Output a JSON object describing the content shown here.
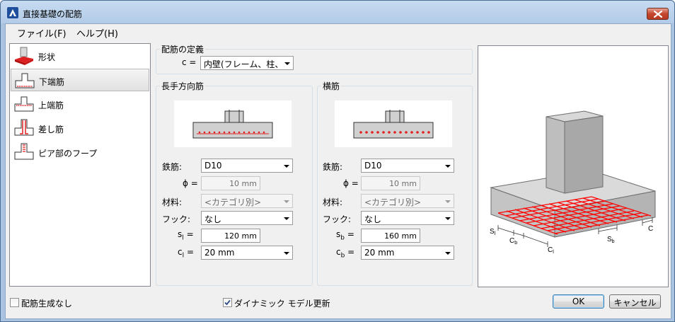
{
  "window": {
    "title": "直接基礎の配筋",
    "close_icon": "close-icon"
  },
  "menu": {
    "file": "ファイル(F)",
    "help": "ヘルプ(H)"
  },
  "sidebar": {
    "items": [
      {
        "label": "形状",
        "icon": "footing-shape-icon"
      },
      {
        "label": "下端筋",
        "icon": "bottom-rebar-icon"
      },
      {
        "label": "上端筋",
        "icon": "top-rebar-icon"
      },
      {
        "label": "差し筋",
        "icon": "dowel-rebar-icon"
      },
      {
        "label": "ピア部のフープ",
        "icon": "pier-hoop-icon"
      }
    ],
    "selected_index": 1
  },
  "definition": {
    "title": "配筋の定義",
    "c_label": "c =",
    "c_value": "内壁(フレーム、柱、およ"
  },
  "longitudinal": {
    "title": "長手方向筋",
    "bar_label": "鉄筋:",
    "bar_value": "D10",
    "phi_label": "ϕ =",
    "phi_value": "10 mm",
    "material_label": "材料:",
    "material_value": "<カテゴリ別>",
    "hook_label": "フック:",
    "hook_value": "なし",
    "spacing_label_main": "s",
    "spacing_label_sub": "l",
    "spacing_label_eq": "=",
    "spacing_value": "120 mm",
    "cover_label_main": "c",
    "cover_label_sub": "l",
    "cover_label_eq": "=",
    "cover_value": "20 mm"
  },
  "transverse": {
    "title": "横筋",
    "bar_label": "鉄筋:",
    "bar_value": "D10",
    "phi_label": "ϕ =",
    "phi_value": "10 mm",
    "material_label": "材料:",
    "material_value": "<カテゴリ別>",
    "hook_label": "フック:",
    "hook_value": "なし",
    "spacing_label_main": "s",
    "spacing_label_sub": "b",
    "spacing_label_eq": "=",
    "spacing_value": "160 mm",
    "cover_label_main": "c",
    "cover_label_sub": "b",
    "cover_label_eq": "=",
    "cover_value": "20 mm"
  },
  "preview": {
    "labels": {
      "s_l_main": "S",
      "s_l_sub": "l",
      "c_b_main": "C",
      "c_b_sub": "b",
      "c_l_main": "C",
      "c_l_sub": "l",
      "s_b_main": "S",
      "s_b_sub": "b",
      "c": "C"
    },
    "rebar_color": "#ff0000",
    "concrete_color": "#c8c8c8"
  },
  "footer": {
    "no_rebar_label": "配筋生成なし",
    "no_rebar_checked": false,
    "dynamic_update_label": "ダイナミック モデル更新",
    "dynamic_update_checked": true,
    "ok_label": "OK",
    "cancel_label": "キャンセル"
  }
}
